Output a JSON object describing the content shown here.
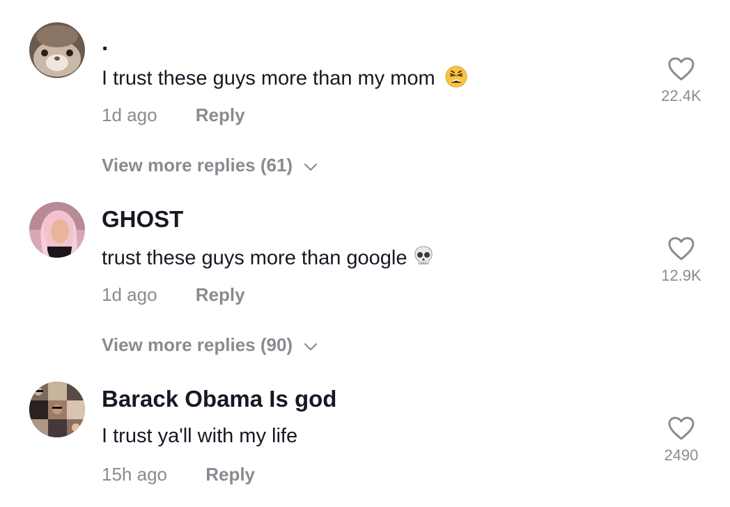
{
  "comments": [
    {
      "username": ".",
      "text": "I trust these guys more than my mom",
      "emoji": "weary-face",
      "time": "1d ago",
      "reply_label": "Reply",
      "likes": "22.4K",
      "more_replies": "View more replies (61)"
    },
    {
      "username": "GHOST",
      "text": "trust these guys more than google",
      "emoji": "skull",
      "time": "1d ago",
      "reply_label": "Reply",
      "likes": "12.9K",
      "more_replies": "View more replies (90)"
    },
    {
      "username": "Barack Obama Is god",
      "text": "I trust ya'll with my life",
      "time": "15h ago",
      "reply_label": "Reply",
      "likes": "2490"
    }
  ]
}
